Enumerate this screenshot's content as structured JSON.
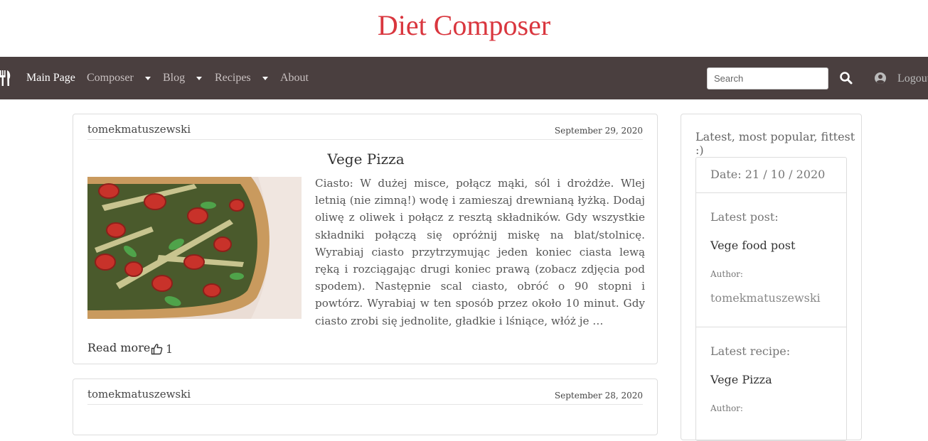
{
  "site": {
    "title": "Diet Composer"
  },
  "nav": {
    "items": [
      {
        "label": "Main Page",
        "active": true,
        "dropdown": false
      },
      {
        "label": "Composer",
        "active": false,
        "dropdown": true
      },
      {
        "label": "Blog",
        "active": false,
        "dropdown": true
      },
      {
        "label": "Recipes",
        "active": false,
        "dropdown": true
      },
      {
        "label": "About",
        "active": false,
        "dropdown": false
      }
    ],
    "search_placeholder": "Search",
    "logout_label": "Logout",
    "logo_icon": "utensils-icon",
    "search_icon": "search-icon",
    "user_icon": "user-circle-icon",
    "background_color": "#4a3f3f"
  },
  "posts": [
    {
      "author": "tomekmatuszewski",
      "date": "September 29, 2020",
      "title": "Vege Pizza",
      "excerpt": "Ciasto: W dużej misce, połącz mąki, sól i drożdże. Wlej letnią (nie zimną!) wodę i zamieszaj drewnianą łyżką. Dodaj oliwę z oliwek i połącz z resztą składników. Gdy wszystkie składniki połączą się opróżnij miskę na blat/stolnicę. Wyrabiaj ciasto przytrzymując jeden koniec ciasta lewą ręką i rozciągając drugi koniec prawą (zobacz zdjęcia pod spodem). Następnie scal ciasto, obróć o 90 stopni i powtórz. Wyrabiaj w ten sposób przez około 10 minut. Gdy ciasto zrobi się jednolite, gładkie i lśniące, włóż je …",
      "read_more": "Read more",
      "likes": "1"
    },
    {
      "author": "tomekmatuszewski",
      "date": "September 28, 2020"
    }
  ],
  "sidebar": {
    "header": "Latest, most popular, fittest :)",
    "date": "Date: 21 / 10 / 2020",
    "latest_post_label": "Latest post:",
    "latest_post_title": "Vege food post",
    "author_label": "Author:",
    "latest_post_author": "tomekmatuszewski",
    "latest_recipe_label": "Latest recipe:",
    "latest_recipe_title": "Vege Pizza",
    "recipe_author_label": "Author:"
  },
  "colors": {
    "title": "#d9363e",
    "navbar": "#4a3f3f"
  }
}
